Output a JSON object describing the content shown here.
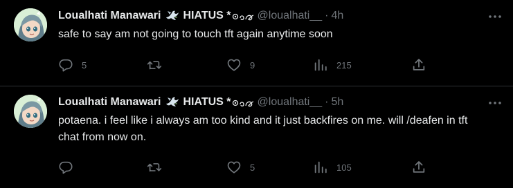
{
  "tweets": [
    {
      "display_name": "Loualhati Manawari",
      "name_badge": "HIATUS *",
      "handle": "@loualhati__",
      "separator": "·",
      "time": "4h",
      "text": "safe to say am not going to touch tft again anytime soon",
      "replies": "5",
      "retweets": "",
      "likes": "9",
      "views": "215"
    },
    {
      "display_name": "Loualhati Manawari",
      "name_badge": "HIATUS *",
      "handle": "@loualhati__",
      "separator": "·",
      "time": "5h",
      "text": "potaena. i feel like i always am too kind and it just backfires on me. will /deafen in tft chat from now on.",
      "replies": "",
      "retweets": "",
      "likes": "5",
      "views": "105"
    }
  ],
  "icons": {
    "avatar": "anime-avatar",
    "name_emoji": "dove-icon",
    "name_deco": "swirl-deco-icon",
    "more": "more-icon",
    "reply": "reply-icon",
    "retweet": "retweet-icon",
    "like": "heart-icon",
    "views": "views-icon",
    "share": "share-icon"
  },
  "colors": {
    "background": "#000000",
    "text": "#e7e9ea",
    "secondary": "#71767b",
    "divider": "#2f3336"
  }
}
